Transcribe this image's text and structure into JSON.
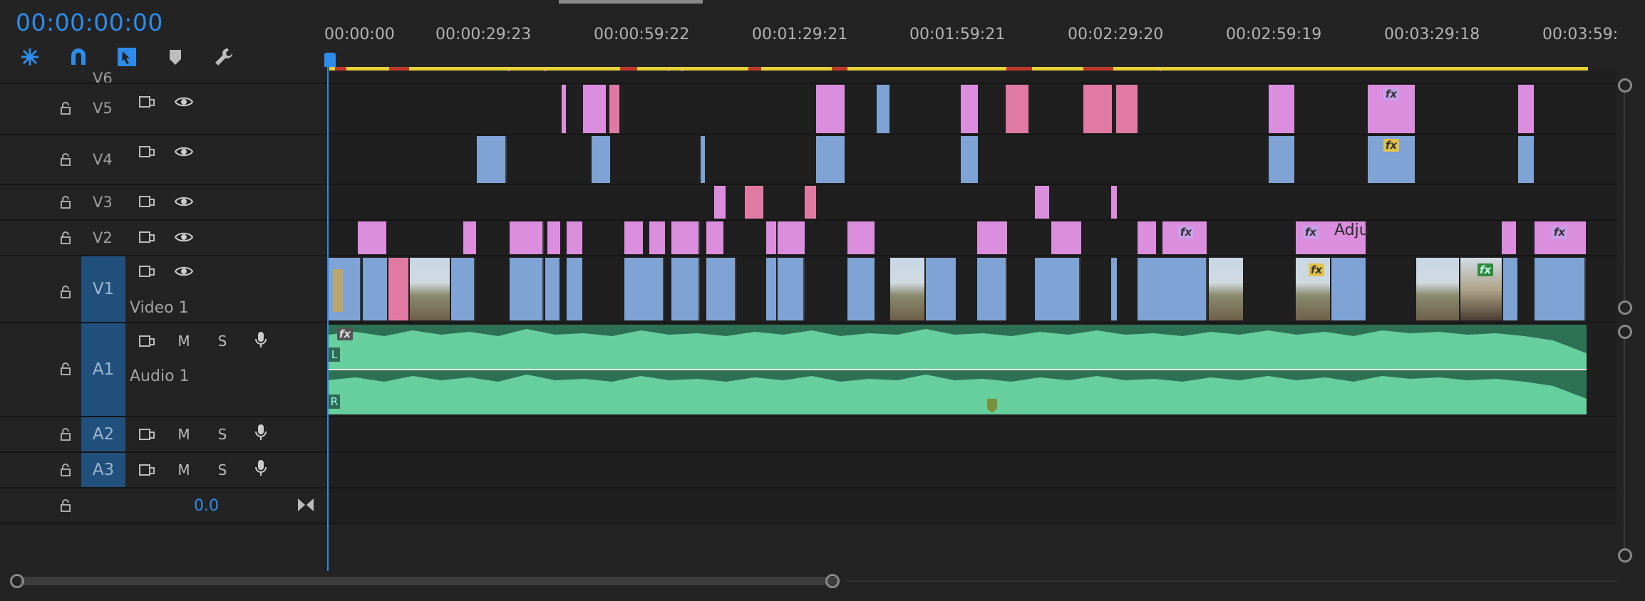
{
  "timecode": "00:00:00:00",
  "tools": [
    {
      "name": "ripple-sequence-icon"
    },
    {
      "name": "snap-magnet-icon"
    },
    {
      "name": "linked-selection-icon"
    },
    {
      "name": "add-marker-icon"
    },
    {
      "name": "wrench-settings-icon"
    }
  ],
  "ruler_labels": [
    "00:00:00",
    "00:00:29:23",
    "00:00:59:22",
    "00:01:29:21",
    "00:01:59:21",
    "00:02:29:20",
    "00:02:59:19",
    "00:03:29:18",
    "00:03:59:"
  ],
  "tracks": {
    "v6": {
      "label": "V6"
    },
    "v5": {
      "label": "V5"
    },
    "v4": {
      "label": "V4"
    },
    "v3": {
      "label": "V3"
    },
    "v2": {
      "label": "V2",
      "clip_text": "Adju"
    },
    "v1": {
      "label": "V1",
      "name": "Video 1"
    },
    "a1": {
      "label": "A1",
      "name": "Audio 1",
      "mute": "M",
      "solo": "S",
      "ch_left": "L",
      "ch_right": "R"
    },
    "a2": {
      "label": "A2",
      "mute": "M",
      "solo": "S"
    },
    "a3": {
      "label": "A3",
      "mute": "M",
      "solo": "S"
    }
  },
  "master": {
    "level": "0.0"
  },
  "fx_label": "fx",
  "colors": {
    "accent": "#2d8ceb",
    "video_clip": "#7ea3d4",
    "adjustment_clip": "#dc8ede",
    "audio_clip": "#66cf9d",
    "work_area": "#e6d33a"
  }
}
